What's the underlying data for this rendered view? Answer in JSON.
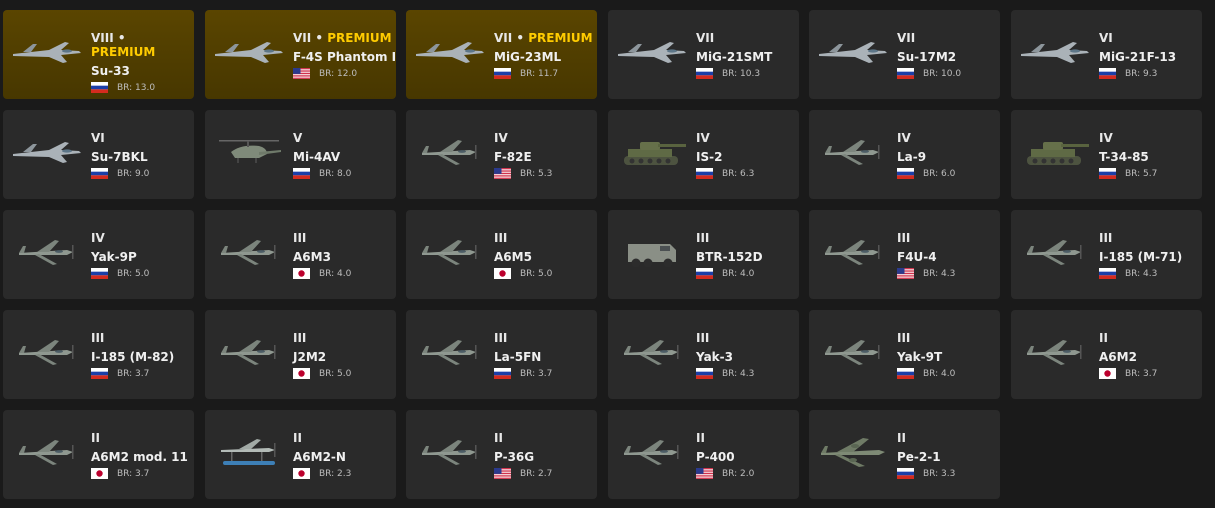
{
  "vehicles": [
    {
      "rank": "VIII",
      "premium": true,
      "premium_label": "PREMIUM",
      "name": "Su-33",
      "country": "russia",
      "country_flag_icon": "russia-flag-icon",
      "br": "BR: 13.0",
      "type": "jet"
    },
    {
      "rank": "VII",
      "premium": true,
      "premium_label": "PREMIUM",
      "name": "F-4S Phantom II",
      "country": "usa",
      "country_flag_icon": "usa-flag-icon",
      "br": "BR: 12.0",
      "type": "jet"
    },
    {
      "rank": "VII",
      "premium": true,
      "premium_label": "PREMIUM",
      "name": "MiG-23ML",
      "country": "russia",
      "country_flag_icon": "russia-flag-icon",
      "br": "BR: 11.7",
      "type": "jet"
    },
    {
      "rank": "VII",
      "premium": false,
      "name": "MiG-21SMT",
      "country": "russia",
      "country_flag_icon": "russia-flag-icon",
      "br": "BR: 10.3",
      "type": "jet"
    },
    {
      "rank": "VII",
      "premium": false,
      "name": "Su-17M2",
      "country": "russia",
      "country_flag_icon": "russia-flag-icon",
      "br": "BR: 10.0",
      "type": "jet"
    },
    {
      "rank": "VI",
      "premium": false,
      "name": "MiG-21F-13",
      "country": "russia",
      "country_flag_icon": "russia-flag-icon",
      "br": "BR: 9.3",
      "type": "jet"
    },
    {
      "rank": "VI",
      "premium": false,
      "name": "Su-7BKL",
      "country": "russia",
      "country_flag_icon": "russia-flag-icon",
      "br": "BR: 9.0",
      "type": "jet"
    },
    {
      "rank": "V",
      "premium": false,
      "name": "Mi-4AV",
      "country": "russia",
      "country_flag_icon": "russia-flag-icon",
      "br": "BR: 8.0",
      "type": "heli"
    },
    {
      "rank": "IV",
      "premium": false,
      "name": "F-82E",
      "country": "usa",
      "country_flag_icon": "usa-flag-icon",
      "br": "BR: 5.3",
      "type": "prop"
    },
    {
      "rank": "IV",
      "premium": false,
      "name": "IS-2",
      "country": "russia",
      "country_flag_icon": "russia-flag-icon",
      "br": "BR: 6.3",
      "type": "tank"
    },
    {
      "rank": "IV",
      "premium": false,
      "name": "La-9",
      "country": "russia",
      "country_flag_icon": "russia-flag-icon",
      "br": "BR: 6.0",
      "type": "prop"
    },
    {
      "rank": "IV",
      "premium": false,
      "name": "T-34-85",
      "country": "russia",
      "country_flag_icon": "russia-flag-icon",
      "br": "BR: 5.7",
      "type": "tank"
    },
    {
      "rank": "IV",
      "premium": false,
      "name": "Yak-9P",
      "country": "russia",
      "country_flag_icon": "russia-flag-icon",
      "br": "BR: 5.0",
      "type": "prop"
    },
    {
      "rank": "III",
      "premium": false,
      "name": "A6M3",
      "country": "japan",
      "country_flag_icon": "japan-flag-icon",
      "br": "BR: 4.0",
      "type": "prop"
    },
    {
      "rank": "III",
      "premium": false,
      "name": "A6M5",
      "country": "japan",
      "country_flag_icon": "japan-flag-icon",
      "br": "BR: 5.0",
      "type": "prop"
    },
    {
      "rank": "III",
      "premium": false,
      "name": "BTR-152D",
      "country": "russia",
      "country_flag_icon": "russia-flag-icon",
      "br": "BR: 4.0",
      "type": "truck"
    },
    {
      "rank": "III",
      "premium": false,
      "name": "F4U-4",
      "country": "usa",
      "country_flag_icon": "usa-flag-icon",
      "br": "BR: 4.3",
      "type": "prop"
    },
    {
      "rank": "III",
      "premium": false,
      "name": "I-185 (M-71)",
      "country": "russia",
      "country_flag_icon": "russia-flag-icon",
      "br": "BR: 4.3",
      "type": "prop"
    },
    {
      "rank": "III",
      "premium": false,
      "name": "I-185 (M-82)",
      "country": "russia",
      "country_flag_icon": "russia-flag-icon",
      "br": "BR: 3.7",
      "type": "prop"
    },
    {
      "rank": "III",
      "premium": false,
      "name": "J2M2",
      "country": "japan",
      "country_flag_icon": "japan-flag-icon",
      "br": "BR: 5.0",
      "type": "prop"
    },
    {
      "rank": "III",
      "premium": false,
      "name": "La-5FN",
      "country": "russia",
      "country_flag_icon": "russia-flag-icon",
      "br": "BR: 3.7",
      "type": "prop"
    },
    {
      "rank": "III",
      "premium": false,
      "name": "Yak-3",
      "country": "russia",
      "country_flag_icon": "russia-flag-icon",
      "br": "BR: 4.3",
      "type": "prop"
    },
    {
      "rank": "III",
      "premium": false,
      "name": "Yak-9T",
      "country": "russia",
      "country_flag_icon": "russia-flag-icon",
      "br": "BR: 4.0",
      "type": "prop"
    },
    {
      "rank": "II",
      "premium": false,
      "name": "A6M2",
      "country": "japan",
      "country_flag_icon": "japan-flag-icon",
      "br": "BR: 3.7",
      "type": "prop"
    },
    {
      "rank": "II",
      "premium": false,
      "name": "A6M2 mod. 11",
      "country": "japan",
      "country_flag_icon": "japan-flag-icon",
      "br": "BR: 3.7",
      "type": "prop"
    },
    {
      "rank": "II",
      "premium": false,
      "name": "A6M2-N",
      "country": "japan",
      "country_flag_icon": "japan-flag-icon",
      "br": "BR: 2.3",
      "type": "float"
    },
    {
      "rank": "II",
      "premium": false,
      "name": "P-36G",
      "country": "usa",
      "country_flag_icon": "usa-flag-icon",
      "br": "BR: 2.7",
      "type": "prop"
    },
    {
      "rank": "II",
      "premium": false,
      "name": "P-400",
      "country": "usa",
      "country_flag_icon": "usa-flag-icon",
      "br": "BR: 2.0",
      "type": "prop"
    },
    {
      "rank": "II",
      "premium": false,
      "name": "Pe-2-1",
      "country": "russia",
      "country_flag_icon": "russia-flag-icon",
      "br": "BR: 3.3",
      "type": "bomber"
    }
  ],
  "colors": {
    "card_bg": "#2a2a2a",
    "premium_bg": "#4f3e00",
    "premium_text": "#ffcc00",
    "page_bg": "#1a1a1a"
  }
}
